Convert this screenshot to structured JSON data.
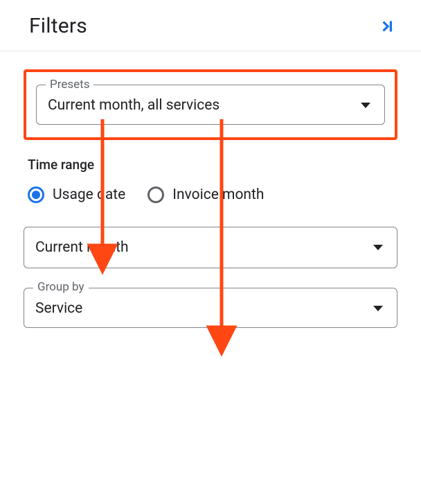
{
  "header": {
    "title": "Filters"
  },
  "presets": {
    "label": "Presets",
    "value": "Current month, all services"
  },
  "timeRange": {
    "sectionLabel": "Time range",
    "radios": {
      "usage": "Usage date",
      "invoice": "Invoice month"
    },
    "periodValue": "Current month"
  },
  "groupBy": {
    "label": "Group by",
    "value": "Service"
  }
}
